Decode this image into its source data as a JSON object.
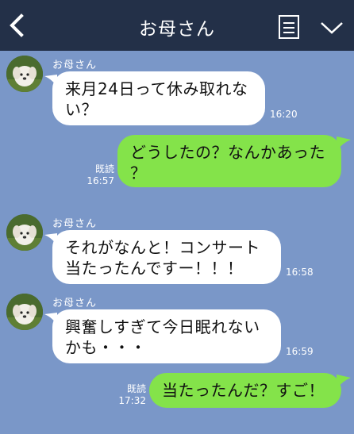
{
  "header": {
    "title": "お母さん"
  },
  "messages": [
    {
      "sender": "お母さん",
      "text": "来月24日って休み取れない？",
      "line1": "来月24日って休み取れな",
      "line2": "い？",
      "time": "16:20"
    },
    {
      "sender": "me",
      "line1": "どうしたの？なんかあった",
      "line2": "？",
      "read": "既読",
      "time": "16:57"
    },
    {
      "sender": "お母さん",
      "line1": "それがなんと！コンサート",
      "line2": "当たったんですー！！！",
      "time": "16:58"
    },
    {
      "sender": "お母さん",
      "line1": "興奮しすぎて今日眠れない",
      "line2": "かも・・・",
      "time": "16:59"
    },
    {
      "sender": "me",
      "line1": "当たったんだ？すご！",
      "read": "既読",
      "time": "17:32"
    }
  ],
  "colors": {
    "background": "#7a97c8",
    "header": "#233048",
    "incoming_bubble": "#ffffff",
    "outgoing_bubble": "#84e34a"
  },
  "icons": {
    "back": "chevron-left-icon",
    "menu": "list-icon",
    "expand": "chevron-down-icon"
  }
}
